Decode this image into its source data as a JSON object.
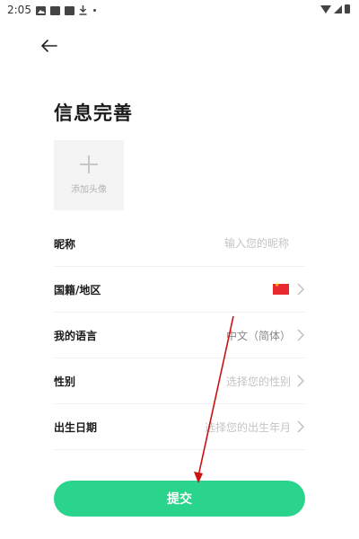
{
  "status_bar": {
    "time": "2:05",
    "icons": [
      "gallery-icon",
      "app-icon",
      "app-icon",
      "download-icon",
      "dot-icon"
    ],
    "right_icons": [
      "wifi-icon",
      "signal-icon",
      "battery-icon"
    ]
  },
  "header": {
    "back_icon": "arrow-left-icon"
  },
  "page": {
    "title": "信息完善"
  },
  "avatar": {
    "label": "添加头像",
    "icon": "plus-icon"
  },
  "form": {
    "nickname": {
      "label": "昵称",
      "placeholder": "输入您的昵称"
    },
    "nationality": {
      "label": "国籍/地区",
      "flag": "china-flag-icon"
    },
    "language": {
      "label": "我的语言",
      "value": "中文（简体）"
    },
    "gender": {
      "label": "性别",
      "value": "选择您的性别"
    },
    "birthday": {
      "label": "出生日期",
      "value": "选择您的出生年月"
    }
  },
  "submit": {
    "label": "提交"
  },
  "colors": {
    "accent": "#2bd48c",
    "annotation": "#cc1111",
    "flag": "#e8292e"
  }
}
